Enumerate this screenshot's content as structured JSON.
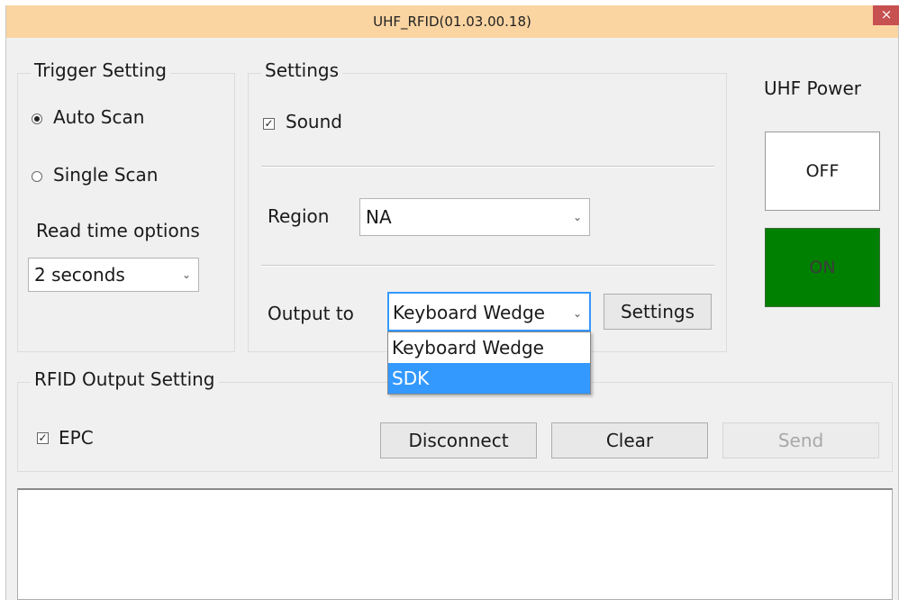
{
  "window": {
    "title": "UHF_RFID(01.03.00.18)",
    "close_glyph": "×"
  },
  "trigger_setting": {
    "legend": "Trigger Setting",
    "auto_scan": {
      "label": "Auto Scan",
      "checked": true
    },
    "single_scan": {
      "label": "Single Scan",
      "checked": false
    },
    "read_time_label": "Read time options",
    "read_time_value": "2 seconds"
  },
  "settings": {
    "legend": "Settings",
    "sound": {
      "label": "Sound",
      "checked": true
    },
    "region_label": "Region",
    "region_value": "NA",
    "output_to_label": "Output to",
    "output_to_value": "Keyboard Wedge",
    "settings_button": "Settings",
    "output_options": [
      {
        "label": "Keyboard Wedge",
        "highlighted": false
      },
      {
        "label": "SDK",
        "highlighted": true
      }
    ]
  },
  "uhf_power": {
    "label": "UHF Power",
    "off_label": "OFF",
    "on_label": "ON",
    "on_color": "#008000"
  },
  "rfid_output": {
    "legend": "RFID Output Setting",
    "epc": {
      "label": "EPC",
      "checked": true
    },
    "disconnect_button": "Disconnect",
    "clear_button": "Clear",
    "send_button": "Send"
  },
  "icons": {
    "check": "✓",
    "chevron": "⌄"
  }
}
